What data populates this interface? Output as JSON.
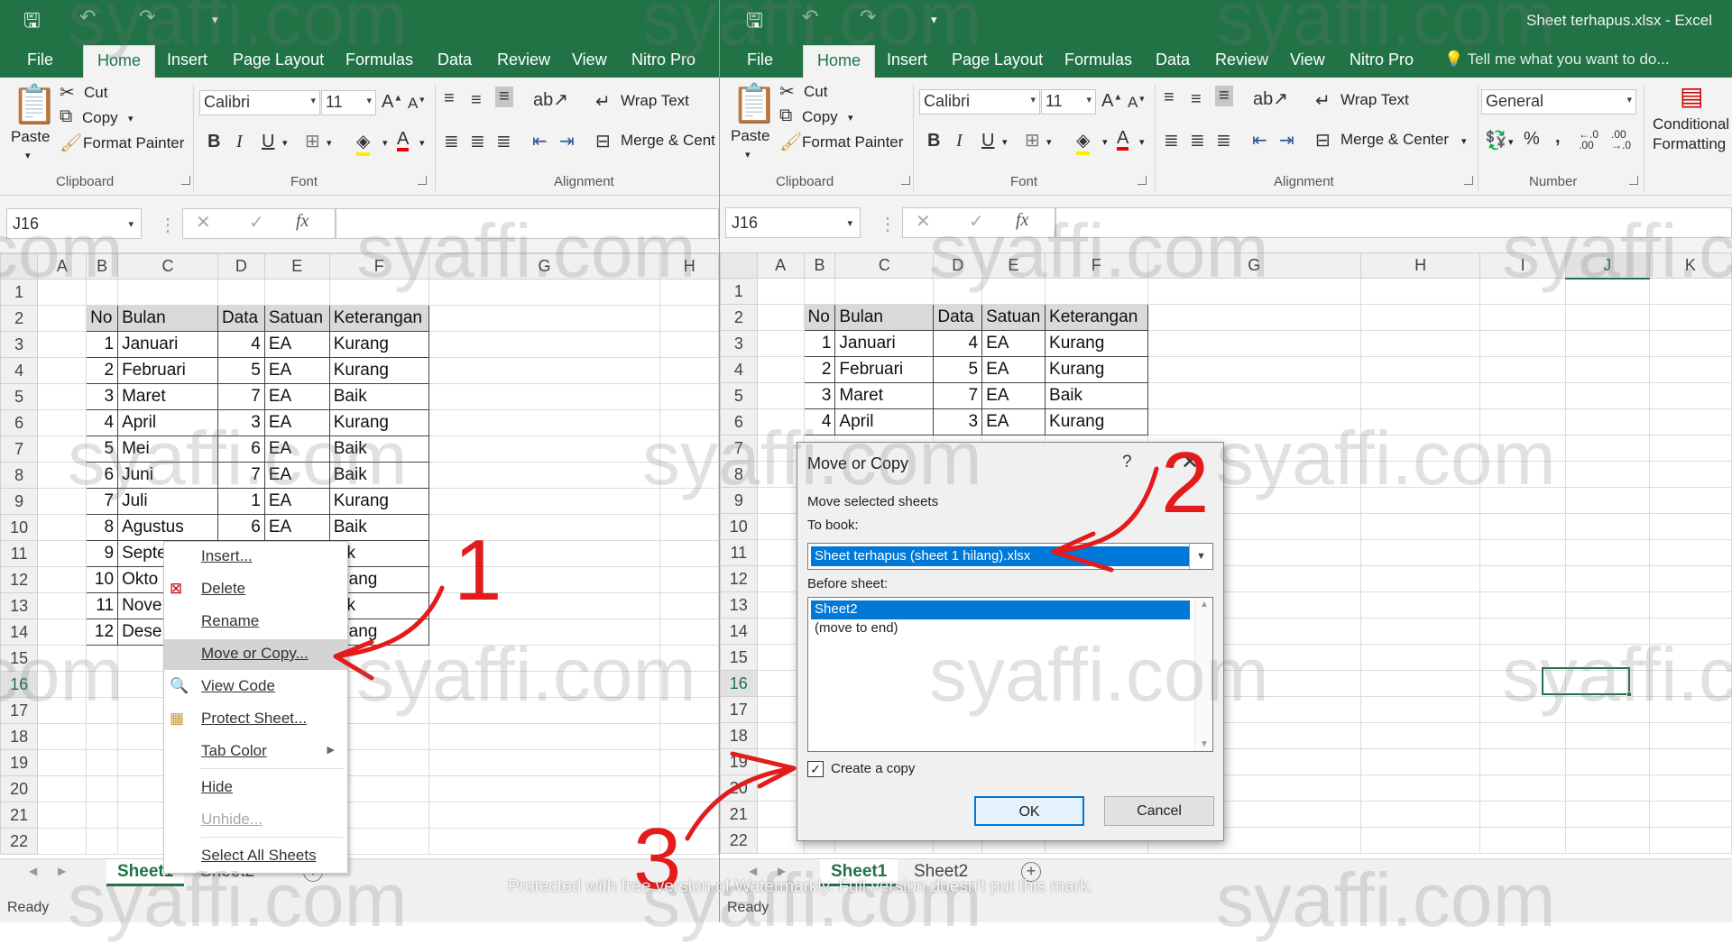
{
  "window_title": "Sheet terhapus.xlsx - Excel",
  "ribbon_tabs": [
    "File",
    "Home",
    "Insert",
    "Page Layout",
    "Formulas",
    "Data",
    "Review",
    "View",
    "Nitro Pro"
  ],
  "tell_me": "Tell me what you want to do...",
  "clipboard": {
    "paste": "Paste",
    "cut": "Cut",
    "copy": "Copy",
    "format_painter": "Format Painter",
    "group": "Clipboard"
  },
  "font": {
    "name": "Calibri",
    "size": "11",
    "group": "Font",
    "bold": "B",
    "italic": "I",
    "underline": "U"
  },
  "alignment": {
    "wrap_text": "Wrap Text",
    "merge_left": "Merge & Cent",
    "merge_right": "Merge & Center",
    "group": "Alignment"
  },
  "number": {
    "format": "General",
    "group": "Number"
  },
  "styles": {
    "conditional_1": "Conditional",
    "conditional_2": "Formatting"
  },
  "name_box": "J16",
  "fx": "fx",
  "columns_left": [
    "A",
    "B",
    "C",
    "D",
    "E",
    "F",
    "G",
    "H"
  ],
  "columns_right": [
    "A",
    "B",
    "C",
    "D",
    "E",
    "F",
    "G",
    "H",
    "I",
    "J",
    "K"
  ],
  "row_numbers": [
    "1",
    "2",
    "3",
    "4",
    "5",
    "6",
    "7",
    "8",
    "9",
    "10",
    "11",
    "12",
    "13",
    "14",
    "15",
    "16",
    "17",
    "18",
    "19",
    "20",
    "21",
    "22"
  ],
  "table_headers": [
    "No",
    "Bulan",
    "Data",
    "Satuan",
    "Keterangan"
  ],
  "table_rows_left": [
    [
      "1",
      "Januari",
      "4",
      "EA",
      "Kurang"
    ],
    [
      "2",
      "Februari",
      "5",
      "EA",
      "Kurang"
    ],
    [
      "3",
      "Maret",
      "7",
      "EA",
      "Baik"
    ],
    [
      "4",
      "April",
      "3",
      "EA",
      "Kurang"
    ],
    [
      "5",
      "Mei",
      "6",
      "EA",
      "Baik"
    ],
    [
      "6",
      "Juni",
      "7",
      "EA",
      "Baik"
    ],
    [
      "7",
      "Juli",
      "1",
      "EA",
      "Kurang"
    ],
    [
      "8",
      "Agustus",
      "6",
      "EA",
      "Baik"
    ],
    [
      "9",
      "Septe",
      "",
      "",
      "aik"
    ],
    [
      "10",
      "Okto",
      "",
      "",
      "urang"
    ],
    [
      "11",
      "Nove",
      "",
      "",
      "aik"
    ],
    [
      "12",
      "Dese",
      "",
      "",
      "urang"
    ]
  ],
  "table_rows_right": [
    [
      "1",
      "Januari",
      "4",
      "EA",
      "Kurang"
    ],
    [
      "2",
      "Februari",
      "5",
      "EA",
      "Kurang"
    ],
    [
      "3",
      "Maret",
      "7",
      "EA",
      "Baik"
    ],
    [
      "4",
      "April",
      "3",
      "EA",
      "Kurang"
    ]
  ],
  "context_menu": {
    "insert": "Insert...",
    "delete": "Delete",
    "rename": "Rename",
    "move_or_copy": "Move or Copy...",
    "view_code": "View Code",
    "protect_sheet": "Protect Sheet...",
    "tab_color": "Tab Color",
    "hide": "Hide",
    "unhide": "Unhide...",
    "select_all": "Select All Sheets"
  },
  "dialog": {
    "title": "Move or Copy",
    "help": "?",
    "close": "✕",
    "subtitle": "Move selected sheets",
    "to_book_label": "To book:",
    "to_book_value": "Sheet terhapus (sheet 1 hilang).xlsx",
    "before_sheet_label": "Before sheet:",
    "before_sheet_options": [
      "Sheet2",
      "(move to end)"
    ],
    "create_copy": "Create a copy",
    "ok": "OK",
    "cancel": "Cancel"
  },
  "sheet_tabs": [
    "Sheet1",
    "Sheet2"
  ],
  "status": "Ready",
  "annotations": [
    "1",
    "2",
    "3"
  ],
  "watermark": "syaffi.com",
  "protected_notice": "Protected with free version of Watermarkly. Full version doesn't put this mark.",
  "colors": {
    "excel_green": "#217346",
    "selection_blue": "#0078d7",
    "annotation_red": "#e31b1b"
  }
}
